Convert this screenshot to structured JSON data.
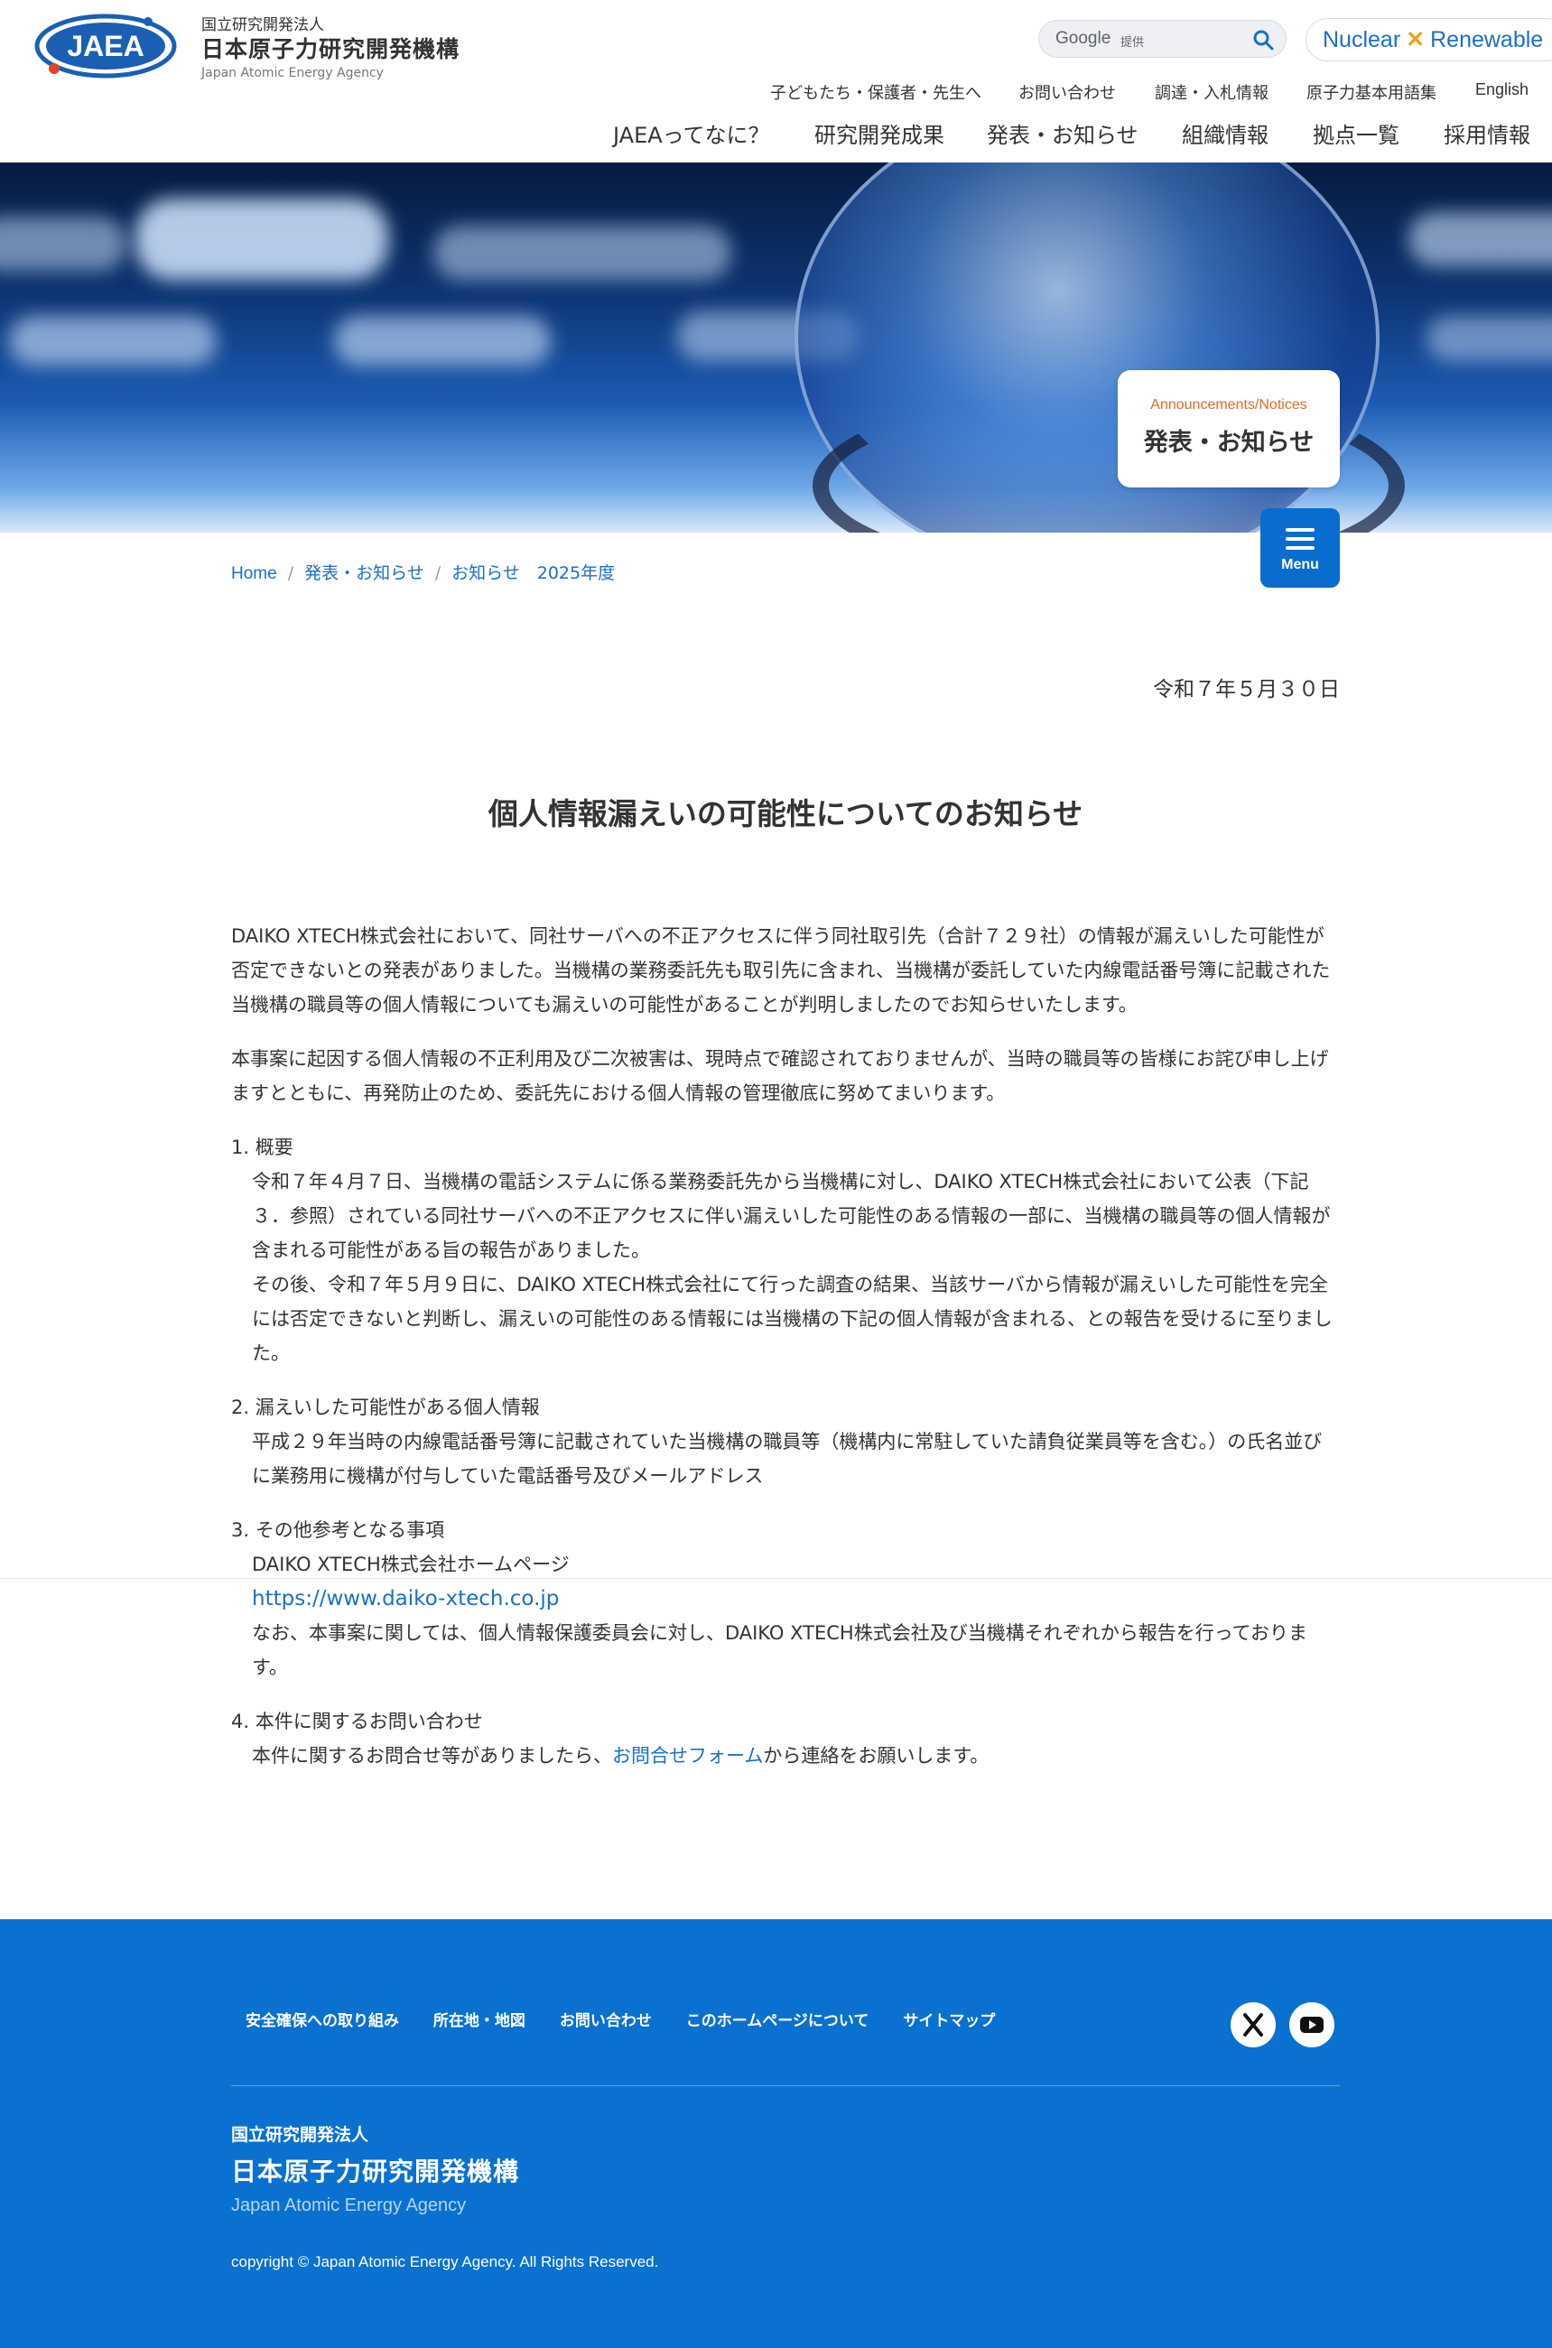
{
  "header": {
    "logo_mark_text": "JAEA",
    "logo_small": "国立研究開発法人",
    "logo_name": "日本原子力研究開発機構",
    "logo_en": "Japan Atomic Energy Agency",
    "search": {
      "brand": "Google",
      "provider": "提供",
      "placeholder": ""
    },
    "nr_button": {
      "left": "Nuclear",
      "sep": "✕",
      "right": "Renewable"
    },
    "util_nav": [
      "子どもたち・保護者・先生へ",
      "お問い合わせ",
      "調達・入札情報",
      "原子力基本用語集",
      "English"
    ],
    "main_nav": [
      "JAEAってなに？",
      "研究開発成果",
      "発表・お知らせ",
      "組織情報",
      "拠点一覧",
      "採用情報"
    ]
  },
  "hero": {
    "card_en": "Announcements/Notices",
    "card_jp": "発表・お知らせ",
    "menu_label": "Menu"
  },
  "breadcrumb": [
    "Home",
    "発表・お知らせ",
    "お知らせ　2025年度"
  ],
  "article": {
    "date": "令和７年５月３０日",
    "title": "個人情報漏えいの可能性についてのお知らせ",
    "para1": "DAIKO XTECH株式会社において、同社サーバへの不正アクセスに伴う同社取引先（合計７２９社）の情報が漏えいした可能性が否定できないとの発表がありました。当機構の業務委託先も取引先に含まれ、当機構が委託していた内線電話番号簿に記載された当機構の職員等の個人情報についても漏えいの可能性があることが判明しましたのでお知らせいたします。",
    "para2": "本事案に起因する個人情報の不正利用及び二次被害は、現時点で確認されておりませんが、当時の職員等の皆様にお詫び申し上げますとともに、再発防止のため、委託先における個人情報の管理徹底に努めてまいります。",
    "sec1_title": "1. 概要",
    "sec1_p1": "令和７年４月７日、当機構の電話システムに係る業務委託先から当機構に対し、DAIKO XTECH株式会社において公表（下記３．参照）されている同社サーバへの不正アクセスに伴い漏えいした可能性のある情報の一部に、当機構の職員等の個人情報が含まれる可能性がある旨の報告がありました。",
    "sec1_p2": "その後、令和７年５月９日に、DAIKO XTECH株式会社にて行った調査の結果、当該サーバから情報が漏えいした可能性を完全には否定できないと判断し、漏えいの可能性のある情報には当機構の下記の個人情報が含まれる、との報告を受けるに至りました。",
    "sec2_title": "2. 漏えいした可能性がある個人情報",
    "sec2_p1": "平成２９年当時の内線電話番号簿に記載されていた当機構の職員等（機構内に常駐していた請負従業員等を含む。）の氏名並びに業務用に機構が付与していた電話番号及びメールアドレス",
    "sec3_title": "3. その他参考となる事項",
    "sec3_p1": "DAIKO XTECH株式会社ホームページ",
    "sec3_url": "https://www.daiko-xtech.co.jp",
    "sec3_p2": "なお、本事案に関しては、個人情報保護委員会に対し、DAIKO XTECH株式会社及び当機構それぞれから報告を行っております。",
    "sec4_title": "4. 本件に関するお問い合わせ",
    "sec4_pre": "本件に関するお問合せ等がありましたら、",
    "sec4_link": "お問合せフォーム",
    "sec4_post": "から連絡をお願いします。"
  },
  "footer": {
    "nav": [
      "安全確保への取り組み",
      "所在地・地図",
      "お問い合わせ",
      "このホームページについて",
      "サイトマップ"
    ],
    "social": [
      "x-icon",
      "youtube-icon"
    ],
    "org_small": "国立研究開発法人",
    "org_name": "日本原子力研究開発機構",
    "org_en": "Japan Atomic Energy Agency",
    "copyright": "copyright © Japan Atomic Energy Agency. All Rights Reserved."
  },
  "colors": {
    "accent": "#0a71d0",
    "link": "#1a6fc8",
    "orange": "#e06a2a"
  }
}
